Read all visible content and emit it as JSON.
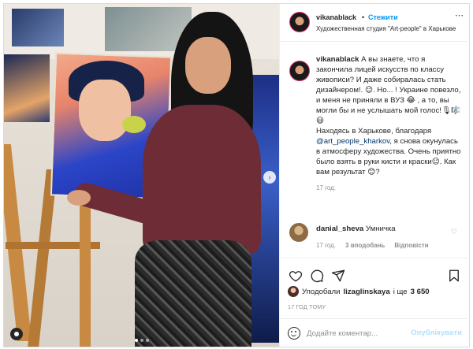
{
  "header": {
    "username": "vikanablack",
    "separator": "•",
    "follow_label": "Стежити",
    "location": "Художественная студия \"Art-people\" в Харькове",
    "more_icon": "more-horizontal-icon"
  },
  "caption": {
    "username": "vikanablack",
    "text_1": "А вы знаете, что я закончила лицей искусств по классу живописи? И даже собиралась стать дизайнером!. 😉. Но... ! Украине повезло, и меня не приняли в ВУЗ 😂 , а то, вы могли бы и не услышать мой голос!🎙🎼😃",
    "text_2": "Находясь в Харькове, благодаря",
    "mention": "@art_people_kharkov",
    "text_3": ", я снова окунулась в атмосферу художества. Очень приятно было взять в руки кисти и краски😉. Как вам результат 😊?",
    "time": "17 год."
  },
  "comment": {
    "username": "danial_sheva",
    "text": "Умничка",
    "time": "17 год.",
    "likes": "3 вподобань",
    "reply_label": "Відповісти"
  },
  "likes": {
    "prefix": "Уподобали",
    "user": "lizaglinskaya",
    "middle": "і ще",
    "count": "3 650"
  },
  "timestamp": "17 год тому",
  "add_comment": {
    "placeholder": "Додайте коментар...",
    "publish_label": "Опублікувати"
  },
  "icons": {
    "like": "heart-icon",
    "comment": "comment-icon",
    "share": "send-icon",
    "save": "bookmark-icon"
  }
}
